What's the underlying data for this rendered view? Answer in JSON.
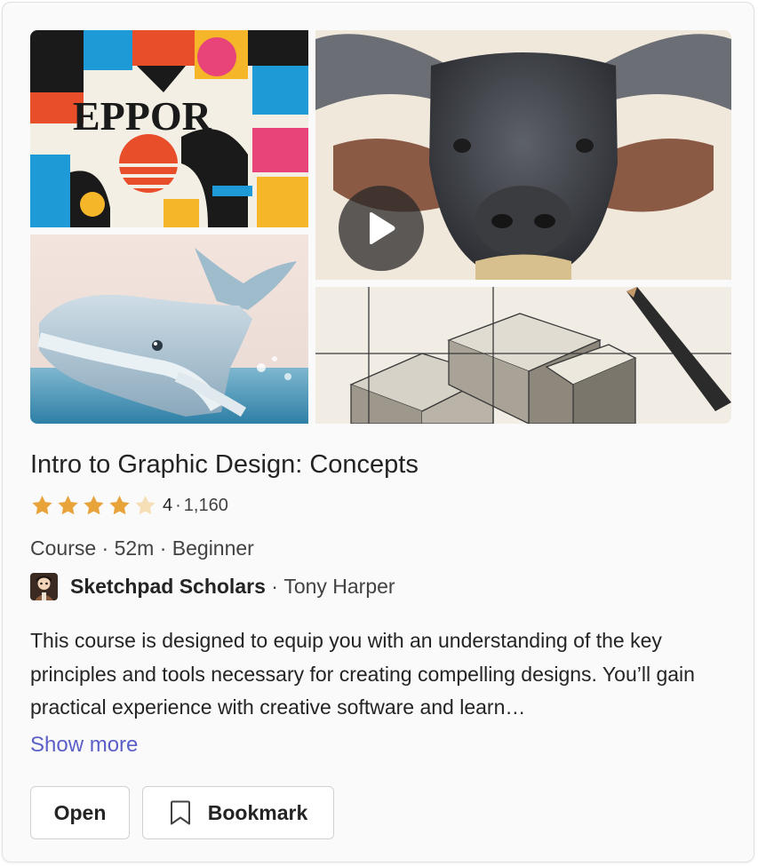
{
  "course": {
    "title": "Intro to Graphic Design: Concepts",
    "rating_value": "4",
    "rating_separator": "·",
    "rating_count": "1,160",
    "rating_stars": 4.5,
    "meta": "Course · 52m · Beginner",
    "organization": "Sketchpad Scholars",
    "author_separator": "·",
    "instructor": "Tony Harper",
    "description": "This course is designed to equip you with an understanding of the key principles and tools necessary for creating compelling designs. You’ll gain practical experience with creative software and learn…",
    "show_more_label": "Show more"
  },
  "gallery": {
    "play_icon": "play-icon",
    "poster_text": "EPPOR"
  },
  "actions": {
    "open_label": "Open",
    "bookmark_label": "Bookmark",
    "bookmark_icon": "bookmark-icon"
  },
  "colors": {
    "accent_link": "#5b5fc7",
    "star": "#e8a33b",
    "star_half": "#f6dfb6"
  }
}
